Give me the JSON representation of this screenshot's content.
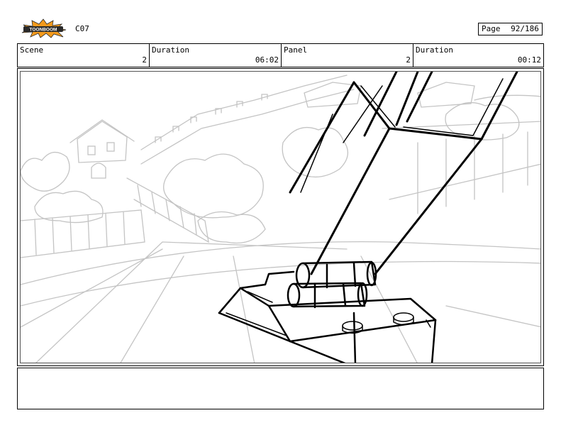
{
  "header": {
    "logo_text": "TOONBOOM",
    "code": "C07",
    "page_label": "Page",
    "page_value": "92/186"
  },
  "info": {
    "scene_label": "Scene",
    "scene_value": "2",
    "duration1_label": "Duration",
    "duration1_value": "06:02",
    "panel_label": "Panel",
    "panel_value": "2",
    "duration2_label": "Duration",
    "duration2_value": "00:12"
  },
  "colors": {
    "logo_orange": "#f39a1c",
    "logo_dark": "#2a2a2a",
    "sketch_light": "#c4c4c4",
    "sketch_dark": "#000000"
  }
}
